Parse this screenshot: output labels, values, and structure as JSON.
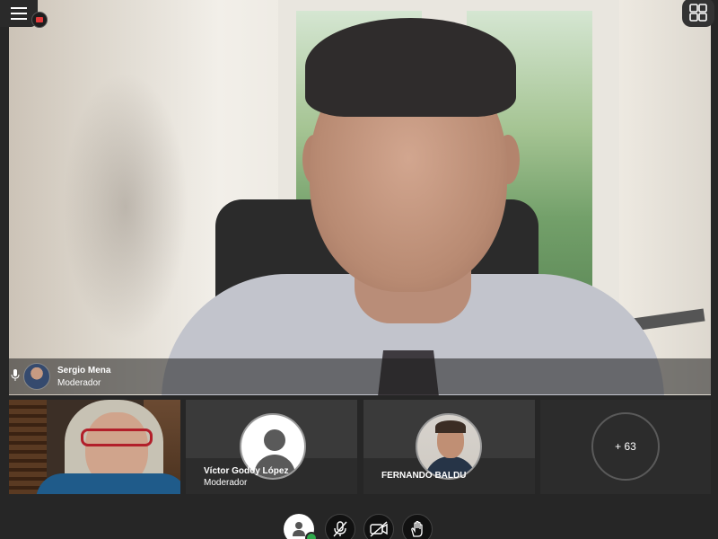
{
  "main_speaker": {
    "name": "Sergio Mena",
    "role": "Moderador"
  },
  "participants": [
    {
      "name": "",
      "role": ""
    },
    {
      "name": "Víctor Godoy López",
      "role": "Moderador"
    },
    {
      "name": "FERNANDO BALDU",
      "role": ""
    }
  ],
  "more_participants": "+ 63",
  "icons": {
    "menu": "hamburger-menu-icon",
    "camera_status": "camera-off-badge-icon",
    "layout": "grid-layout-icon",
    "mic": "microphone-icon",
    "user": "user-icon",
    "mic_muted": "microphone-muted-icon",
    "camera_off": "camera-off-icon",
    "raise_hand": "raise-hand-icon"
  },
  "colors": {
    "background": "#262626",
    "status_online": "#2ea84a",
    "camera_badge": "#e23b3b"
  }
}
